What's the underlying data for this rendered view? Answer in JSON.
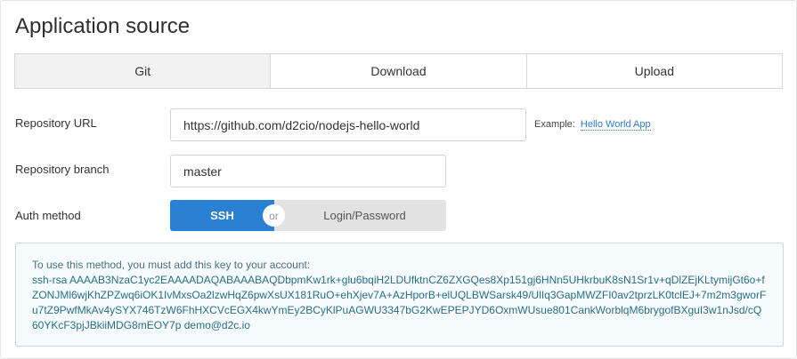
{
  "title": "Application source",
  "tabs": [
    {
      "label": "Git",
      "active": true
    },
    {
      "label": "Download",
      "active": false
    },
    {
      "label": "Upload",
      "active": false
    }
  ],
  "repo_url": {
    "label": "Repository URL",
    "value": "https://github.com/d2cio/nodejs-hello-world",
    "example_prefix": "Example:",
    "example_link": "Hello World App"
  },
  "repo_branch": {
    "label": "Repository branch",
    "value": "master"
  },
  "auth": {
    "label": "Auth method",
    "option_ssh": "SSH",
    "or_text": "or",
    "option_login": "Login/Password",
    "selected": "SSH"
  },
  "ssh_key": {
    "intro": "To use this method, you must add this key to your account:",
    "key": "ssh-rsa AAAAB3NzaC1yc2EAAAADAQABAAABAQDbpmKw1rk+glu6bqiH2LDUfktnCZ6ZXGQes8Xp151gj6HNn5UHkrbuK8sN1Sr1v+qDlZEjKLtymijGt6o+fZONJMl6wjKhZPZwq6iOK1IvMxsOa2lzwHqZ6pwXsUX181RuO+ehXjev7A+AzHporB+elUQLBWSarsk49/UlIq3GapMWZFI0av2tprzLK0tclEJ+7m2m3gworFu7tZ9PwfMkAv4ySYX746TzW6FhHXCVcEGX4kwYmEy2BCyKlPuAGWU3347bG2KwEPEPJYD6OxmWUsue801CankWorblqM6brygofBXguI3w1nJsd/cQ60YKcF3pjJBkiiMDG8mEOY7p demo@d2c.io"
  },
  "colors": {
    "accent": "#2a80d2",
    "link": "#2e7bd0",
    "key_text": "#2a6d86"
  }
}
